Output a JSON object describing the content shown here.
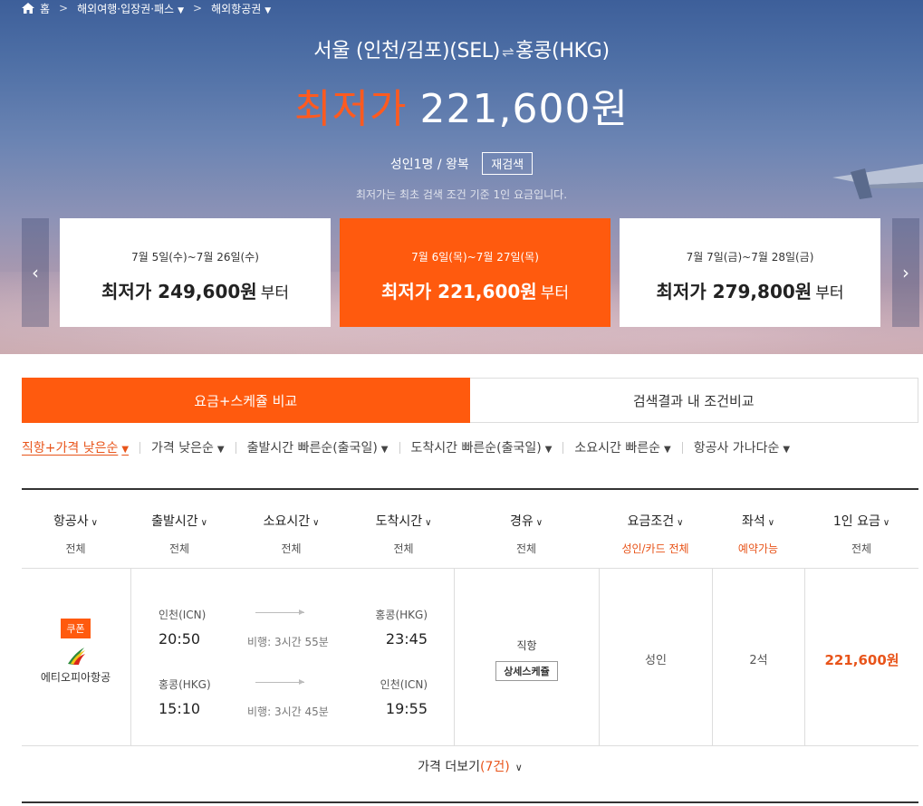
{
  "breadcrumb": {
    "home": "홈",
    "cat1": "해외여행·입장권·패스",
    "cat2": "해외항공권"
  },
  "hero": {
    "route_from": "서울 (인천/김포)(SEL)",
    "route_to": "홍콩(HKG)",
    "lowest_label": "최저가",
    "lowest_amount": "221,600원",
    "pax": "성인1명 / 왕복",
    "research": "재검색",
    "note": "최저가는 최초 검색 조건 기준 1인 요금입니다."
  },
  "date_cards": [
    {
      "dates": "7월 5일(수)~7월 26일(수)",
      "price": "최저가 249,600원",
      "suffix": "부터"
    },
    {
      "dates": "7월 6일(목)~7월 27일(목)",
      "price": "최저가 221,600원",
      "suffix": "부터"
    },
    {
      "dates": "7월 7일(금)~7월 28일(금)",
      "price": "최저가 279,800원",
      "suffix": "부터"
    }
  ],
  "tabs": [
    "요금+스케쥴 비교",
    "검색결과 내 조건비교"
  ],
  "sort": [
    "직항+가격 낮은순",
    "가격 낮은순",
    "출발시간 빠른순(출국일)",
    "도착시간 빠른순(출국일)",
    "소요시간 빠른순",
    "항공사 가나다순"
  ],
  "columns": [
    {
      "h": "항공사",
      "s": "전체"
    },
    {
      "h": "출발시간",
      "s": "전체"
    },
    {
      "h": "소요시간",
      "s": "전체"
    },
    {
      "h": "도착시간",
      "s": "전체"
    },
    {
      "h": "경유",
      "s": "전체"
    },
    {
      "h": "요금조건",
      "s": "성인/카드 전체"
    },
    {
      "h": "좌석",
      "s": "예약가능"
    },
    {
      "h": "1인 요금",
      "s": "전체"
    }
  ],
  "result": {
    "coupon": "쿠폰",
    "airline": "에티오피아항공",
    "legs": [
      {
        "dep_code": "인천(ICN)",
        "dep_time": "20:50",
        "duration": "비행: 3시간 55분",
        "arr_code": "홍콩(HKG)",
        "arr_time": "23:45"
      },
      {
        "dep_code": "홍콩(HKG)",
        "dep_time": "15:10",
        "duration": "비행: 3시간 45분",
        "arr_code": "인천(ICN)",
        "arr_time": "19:55"
      }
    ],
    "via": "직항",
    "detail_btn": "상세스케쥴",
    "fare_cond": "성인",
    "seats": "2석",
    "price": "221,600원"
  },
  "more": {
    "label": "가격 더보기",
    "count": "(7건)"
  }
}
